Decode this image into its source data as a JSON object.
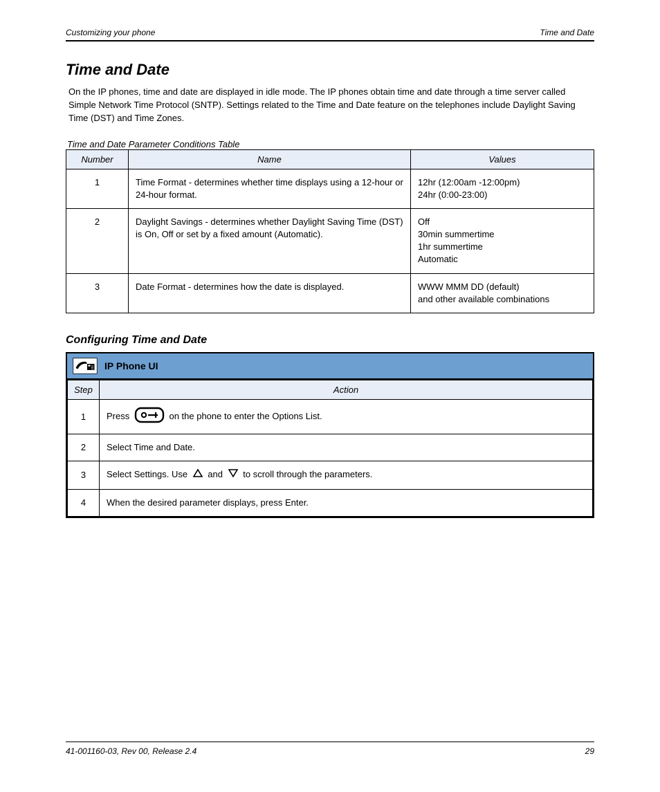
{
  "header": {
    "left": "Customizing your phone",
    "right": "Time and Date"
  },
  "section": {
    "title": "Time and Date",
    "intro": "On the IP phones, time and date are displayed in idle mode. The IP phones obtain time and date through a time server called Simple Network Time Protocol (SNTP). Settings related to the Time and Date feature on the telephones include Daylight Saving Time (DST) and Time Zones.",
    "conditions_caption": "Time and Date Parameter Conditions Table"
  },
  "params_table": {
    "headers": [
      "Number",
      "Name",
      "Values"
    ],
    "rows": [
      {
        "num": "1",
        "name": "Time Format - determines whether time displays using a 12-hour or 24-hour format.",
        "vals": "12hr (12:00am -12:00pm)\n24hr (0:00-23:00)"
      },
      {
        "num": "2",
        "name": "Daylight Savings - determines whether Daylight Saving Time (DST) is On, Off or set by a fixed amount (Automatic).",
        "vals": "Off\n30min summertime\n1hr summertime\nAutomatic"
      },
      {
        "num": "3",
        "name": "Date Format - determines how the date is displayed.",
        "vals": "WWW MMM DD (default)\nand other available combinations"
      }
    ]
  },
  "ipbox": {
    "subheading": "Configuring Time and Date",
    "title": "IP Phone UI",
    "step_header": "Step",
    "action_header": "Action",
    "steps": [
      {
        "n": "1",
        "action_pre": "Press ",
        "action_post": " on the phone to enter the Options List."
      },
      {
        "n": "2",
        "action": "Select Time and Date."
      },
      {
        "n": "3",
        "action_pre": "Select Settings. Use ",
        "action_mid": " and ",
        "action_post": " to scroll through the parameters."
      },
      {
        "n": "4",
        "action": "When the desired parameter displays, press Enter."
      }
    ]
  },
  "footer": {
    "left": "41-001160-03, Rev 00, Release 2.4",
    "right": "29"
  }
}
